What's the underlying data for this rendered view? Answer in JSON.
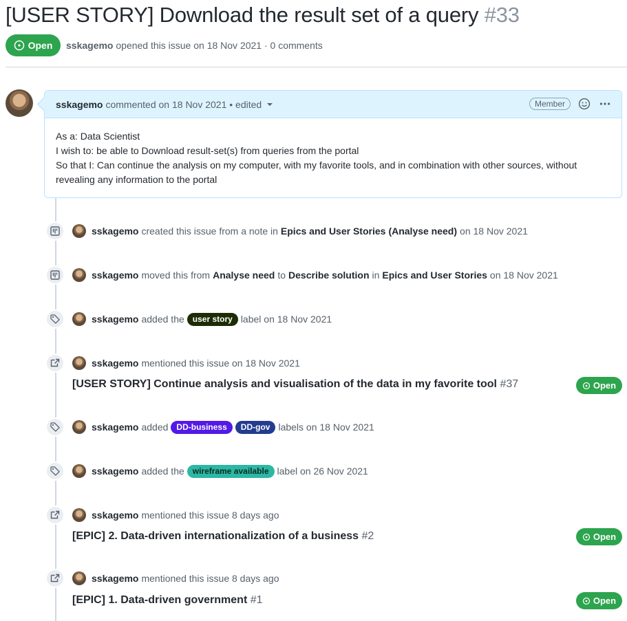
{
  "issue": {
    "title": "[USER STORY] Download the result set of a query",
    "number": "#33",
    "state": "Open",
    "author": "sskagemo",
    "meta_text": "opened this issue on 18 Nov 2021 · 0 comments"
  },
  "comment": {
    "author": "sskagemo",
    "meta": "commented on 18 Nov 2021 • edited",
    "role": "Member",
    "body": [
      "As a: Data Scientist",
      "I wish to: be able to Download result-set(s) from queries from the portal",
      "So that I: Can continue the analysis on my computer, with my favorite tools, and in combination with other sources, without revealing any information to the portal"
    ]
  },
  "events": {
    "e1": {
      "author": "sskagemo",
      "t1": "created this issue from a note in",
      "project": "Epics and User Stories",
      "column": "(Analyse need)",
      "t2": "on 18 Nov 2021"
    },
    "e2": {
      "author": "sskagemo",
      "t1": "moved this from",
      "from": "Analyse need",
      "t2": "to",
      "to": "Describe solution",
      "t3": "in",
      "project": "Epics and User Stories",
      "t4": "on 18 Nov 2021"
    },
    "e3": {
      "author": "sskagemo",
      "t1": "added the",
      "label": "user story",
      "t2": "label on 18 Nov 2021"
    },
    "e4": {
      "author": "sskagemo",
      "t1": "mentioned this issue on 18 Nov 2021",
      "ref_title": "[USER STORY] Continue analysis and visualisation of the data in my favorite tool",
      "ref_num": "#37",
      "ref_state": "Open"
    },
    "e5": {
      "author": "sskagemo",
      "t1": "added",
      "label1": "DD-business",
      "label2": "DD-gov",
      "t2": "labels on 18 Nov 2021"
    },
    "e6": {
      "author": "sskagemo",
      "t1": "added the",
      "label": "wireframe available",
      "t2": "label on 26 Nov 2021"
    },
    "e7": {
      "author": "sskagemo",
      "t1": "mentioned this issue 8 days ago",
      "ref_title": "[EPIC] 2. Data-driven internationalization of a business",
      "ref_num": "#2",
      "ref_state": "Open"
    },
    "e8": {
      "author": "sskagemo",
      "t1": "mentioned this issue 8 days ago",
      "ref_title": "[EPIC] 1. Data-driven government",
      "ref_num": "#1",
      "ref_state": "Open"
    }
  },
  "colors": {
    "open_green": "#2da44e",
    "label_user_story": "#1c2c04",
    "label_dd_business": "#5319e7",
    "label_dd_gov": "#233c8f",
    "label_wireframe": "#2cb8a3"
  }
}
